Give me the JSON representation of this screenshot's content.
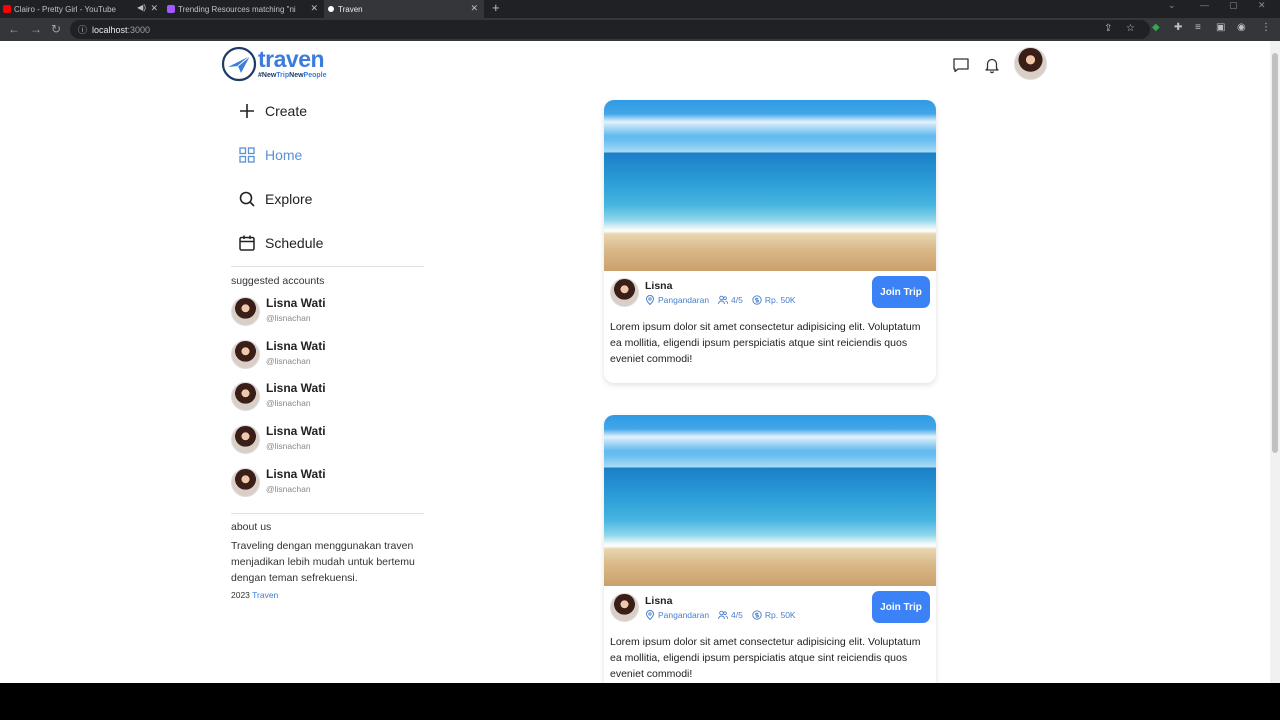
{
  "browser": {
    "tabs": [
      {
        "title": "Clairo - Pretty Girl - YouTube",
        "favicon_color": "#ff0000"
      },
      {
        "title": "Trending Resources matching \"ni",
        "favicon_color": "#a259ff"
      },
      {
        "title": "Traven",
        "favicon_color": "#ffffff"
      }
    ],
    "url_host": "localhost",
    "url_port": ":3000"
  },
  "header": {
    "logo_text": "traven",
    "logo_tag_1": "#New",
    "logo_tag_2": "Trip",
    "logo_tag_3": "New",
    "logo_tag_4": "People"
  },
  "sidebar": {
    "menu": [
      {
        "label": "Create",
        "icon": "plus-icon"
      },
      {
        "label": "Home",
        "icon": "grid-icon"
      },
      {
        "label": "Explore",
        "icon": "search-icon"
      },
      {
        "label": "Schedule",
        "icon": "calendar-icon"
      }
    ],
    "suggested_title": "suggested accounts",
    "accounts": [
      {
        "name": "Lisna Wati",
        "handle": "@lisnachan"
      },
      {
        "name": "Lisna Wati",
        "handle": "@lisnachan"
      },
      {
        "name": "Lisna Wati",
        "handle": "@lisnachan"
      },
      {
        "name": "Lisna Wati",
        "handle": "@lisnachan"
      },
      {
        "name": "Lisna Wati",
        "handle": "@lisnachan"
      }
    ],
    "about_title": "about us",
    "about_text": "Traveling dengan menggunakan traven menjadikan lebih mudah untuk bertemu dengan teman sefrekuensi.",
    "copyright_year": "2023",
    "copyright_brand": "Traven"
  },
  "feed": {
    "posts": [
      {
        "user": "Lisna",
        "location": "Pangandaran",
        "participants": "4/5",
        "price": "Rp. 50K",
        "join_label": "Join Trip",
        "description": "Lorem ipsum dolor sit amet consectetur adipisicing elit. Voluptatum ea mollitia, eligendi ipsum perspiciatis atque sint reiciendis quos eveniet commodi!"
      },
      {
        "user": "Lisna",
        "location": "Pangandaran",
        "participants": "4/5",
        "price": "Rp. 50K",
        "join_label": "Join Trip",
        "description": "Lorem ipsum dolor sit amet consectetur adipisicing elit. Voluptatum ea mollitia, eligendi ipsum perspiciatis atque sint reiciendis quos eveniet commodi!"
      }
    ]
  },
  "colors": {
    "brand": "#3b7dd8",
    "active_menu": "#5b8fd6",
    "join_button": "#3b82f6"
  }
}
